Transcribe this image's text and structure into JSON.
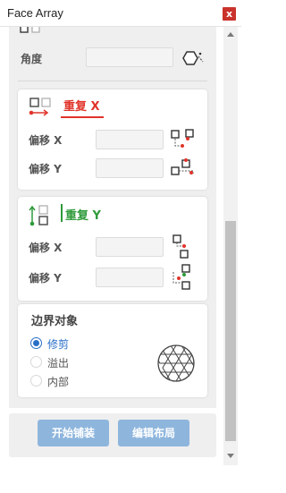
{
  "window": {
    "title": "Face Array",
    "close_label": "x"
  },
  "rotation": {
    "angle_label": "角度",
    "angle_value": ""
  },
  "x_group": {
    "header_label": "重复 X",
    "accent": "#e0342a",
    "offset_x_label": "偏移 X",
    "offset_x_value": "",
    "offset_y_label": "偏移 Y",
    "offset_y_value": ""
  },
  "y_group": {
    "header_label": "重复 Y",
    "accent": "#2e9a3a",
    "offset_x_label": "偏移 X",
    "offset_x_value": "",
    "offset_y_label": "偏移 Y",
    "offset_y_value": ""
  },
  "boundary": {
    "title": "边界对象",
    "options": [
      {
        "label": "修剪",
        "selected": true
      },
      {
        "label": "溢出",
        "selected": false
      },
      {
        "label": "内部",
        "selected": false
      }
    ],
    "selected_color": "#2a6fc7"
  },
  "actions": {
    "start_label": "开始铺装",
    "edit_label": "编辑布局",
    "button_color": "#8eb6dd"
  },
  "icons": {
    "rotate": "rotate-hexagon-icon",
    "repeat_x": "repeat-x-icon",
    "repeat_y": "repeat-y-icon",
    "offset": "offset-icon",
    "pattern": "hexagon-pattern-icon"
  }
}
